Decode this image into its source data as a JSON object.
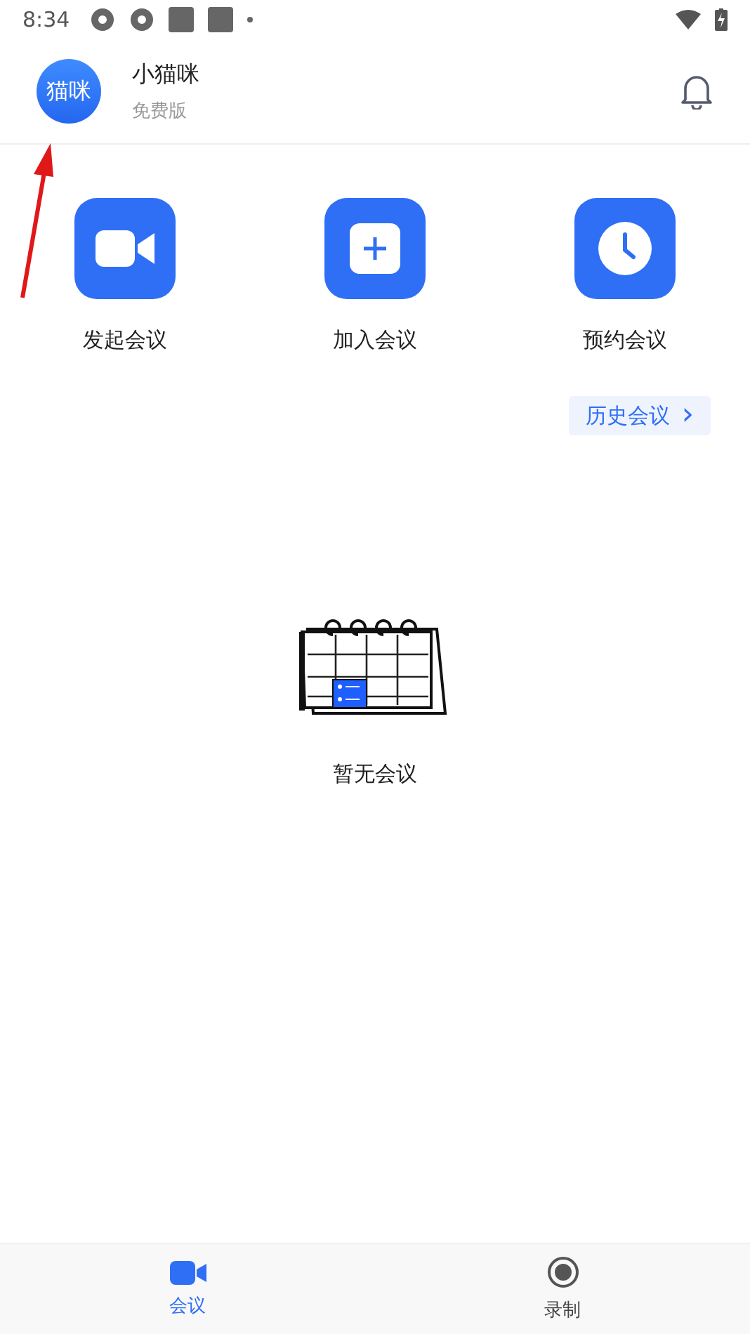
{
  "status_bar": {
    "time": "8:34"
  },
  "profile": {
    "avatar_text": "猫咪",
    "name": "小猫咪",
    "plan": "免费版"
  },
  "actions": [
    {
      "kind": "video",
      "label": "发起会议"
    },
    {
      "kind": "join",
      "label": "加入会议"
    },
    {
      "kind": "schedule",
      "label": "预约会议"
    }
  ],
  "history_button": {
    "label": "历史会议",
    "arrow": "›"
  },
  "empty_state": {
    "message": "暂无会议"
  },
  "bottom_tabs": [
    {
      "kind": "meeting",
      "label": "会议",
      "selected": true
    },
    {
      "kind": "record",
      "label": "录制",
      "selected": false
    }
  ]
}
